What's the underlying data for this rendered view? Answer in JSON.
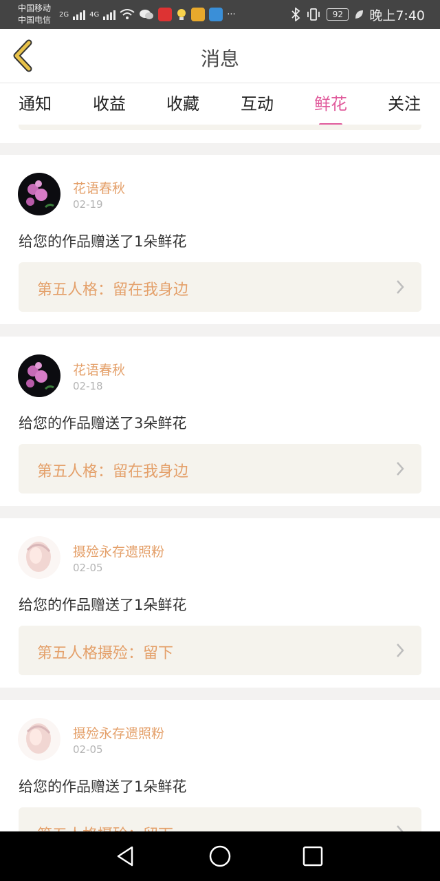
{
  "status_bar": {
    "carrier1": "中国移动",
    "carrier2": "中国电信",
    "net1": "2G",
    "net2": "4G",
    "more": "···",
    "battery": "92",
    "time": "晚上7:40"
  },
  "header": {
    "title": "消息",
    "back_icon": "back-chevron-icon"
  },
  "tabs": [
    {
      "label": "通知"
    },
    {
      "label": "收益"
    },
    {
      "label": "收藏"
    },
    {
      "label": "互动"
    },
    {
      "label": "鲜花",
      "active": true
    },
    {
      "label": "关注"
    }
  ],
  "messages": [
    {
      "name": "花语春秋",
      "date": "02-19",
      "text": "给您的作品赠送了1朵鲜花",
      "work": "第五人格：留在我身边"
    },
    {
      "name": "花语春秋",
      "date": "02-18",
      "text": "给您的作品赠送了3朵鲜花",
      "work": "第五人格：留在我身边"
    },
    {
      "name": "摄殓永存遗照粉",
      "date": "02-05",
      "text": "给您的作品赠送了1朵鲜花",
      "work": "第五人格摄殓：留下"
    },
    {
      "name": "摄殓永存遗照粉",
      "date": "02-05",
      "text": "给您的作品赠送了1朵鲜花",
      "work": "第五人格摄殓：留下"
    }
  ],
  "colors": {
    "accent": "#e05a9b",
    "name": "#e4a06a",
    "card_bg": "#f5f3ed",
    "back_icon": "#e8c24a"
  }
}
